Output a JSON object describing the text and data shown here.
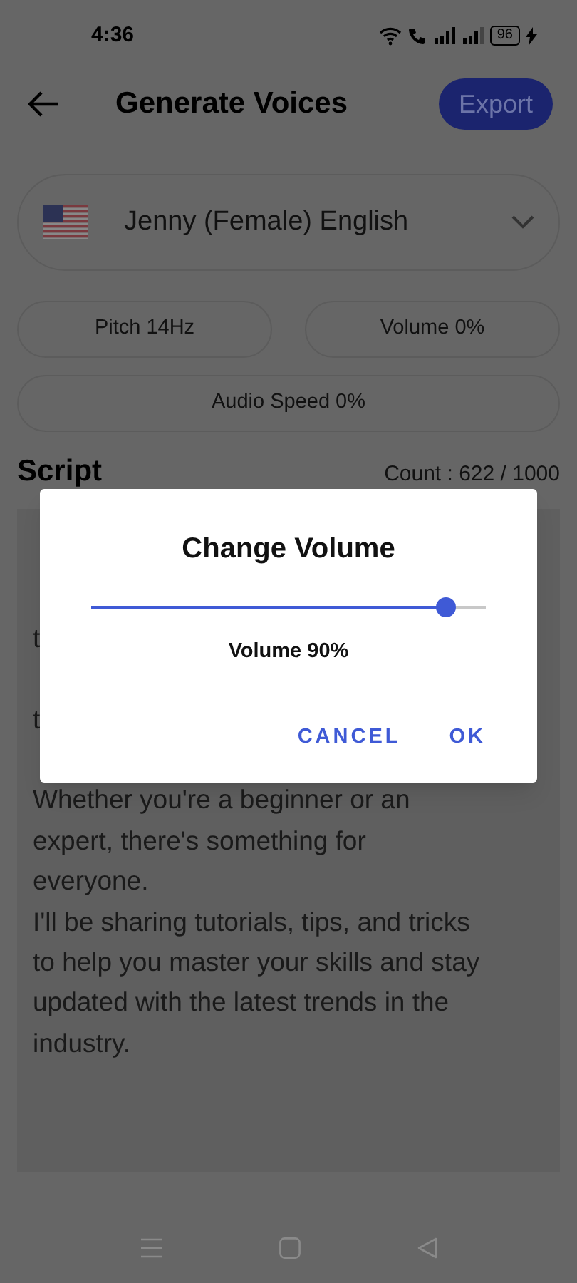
{
  "status_bar": {
    "time": "4:36",
    "battery": "96"
  },
  "header": {
    "title": "Generate Voices",
    "export_button": "Export"
  },
  "voice_select": {
    "value": "Jenny (Female) English"
  },
  "settings": [
    {
      "label": "Pitch 14Hz"
    },
    {
      "label": "Volume 0%"
    },
    {
      "label": "Audio Speed 0%"
    }
  ],
  "script": {
    "heading": "Script",
    "count": "Count : 622 / 1000",
    "covered_fragments": [
      "t",
      "t"
    ],
    "lines": [
      "Whether you're a beginner or an",
      "expert, there's something for",
      "everyone.",
      "I'll be sharing tutorials, tips, and tricks",
      "to help you master your skills and stay",
      "updated with the latest trends in the",
      "industry."
    ]
  },
  "dialog": {
    "title": "Change Volume",
    "slider": {
      "level": 0.9
    },
    "reading": "Volume 90%",
    "buttons": [
      "CANCEL",
      "OK"
    ]
  }
}
